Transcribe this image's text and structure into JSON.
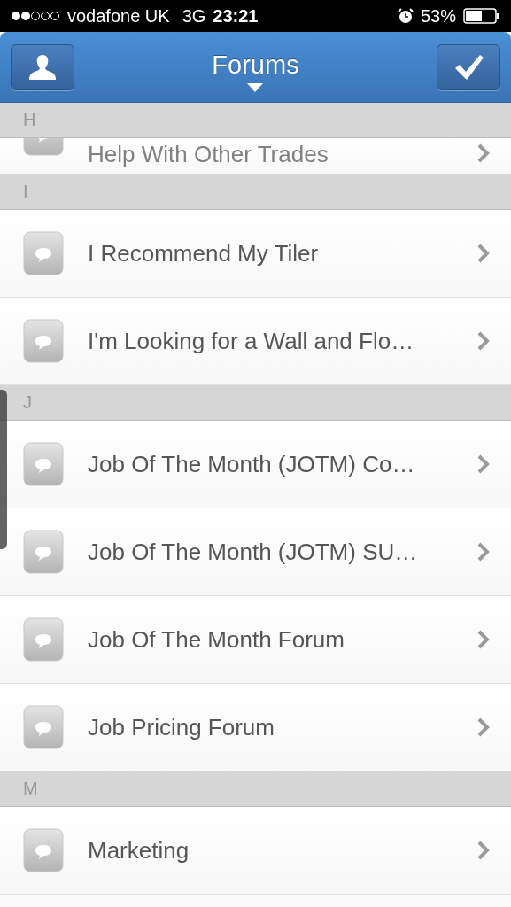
{
  "status_bar": {
    "carrier": "vodafone UK",
    "network": "3G",
    "time": "23:21",
    "battery": "53%"
  },
  "nav_bar": {
    "title": "Forums"
  },
  "sections": [
    {
      "letter": "H",
      "rows": [
        {
          "title": "Help With Other Trades"
        }
      ]
    },
    {
      "letter": "I",
      "rows": [
        {
          "title": "I Recommend My Tiler"
        },
        {
          "title": "I'm Looking for a Wall and Flo…"
        }
      ]
    },
    {
      "letter": "J",
      "rows": [
        {
          "title": "Job Of The Month (JOTM) Co…"
        },
        {
          "title": "Job Of The Month (JOTM) SU…"
        },
        {
          "title": "Job Of The Month Forum"
        },
        {
          "title": "Job Pricing Forum"
        }
      ]
    },
    {
      "letter": "M",
      "rows": [
        {
          "title": "Marketing"
        }
      ]
    }
  ]
}
